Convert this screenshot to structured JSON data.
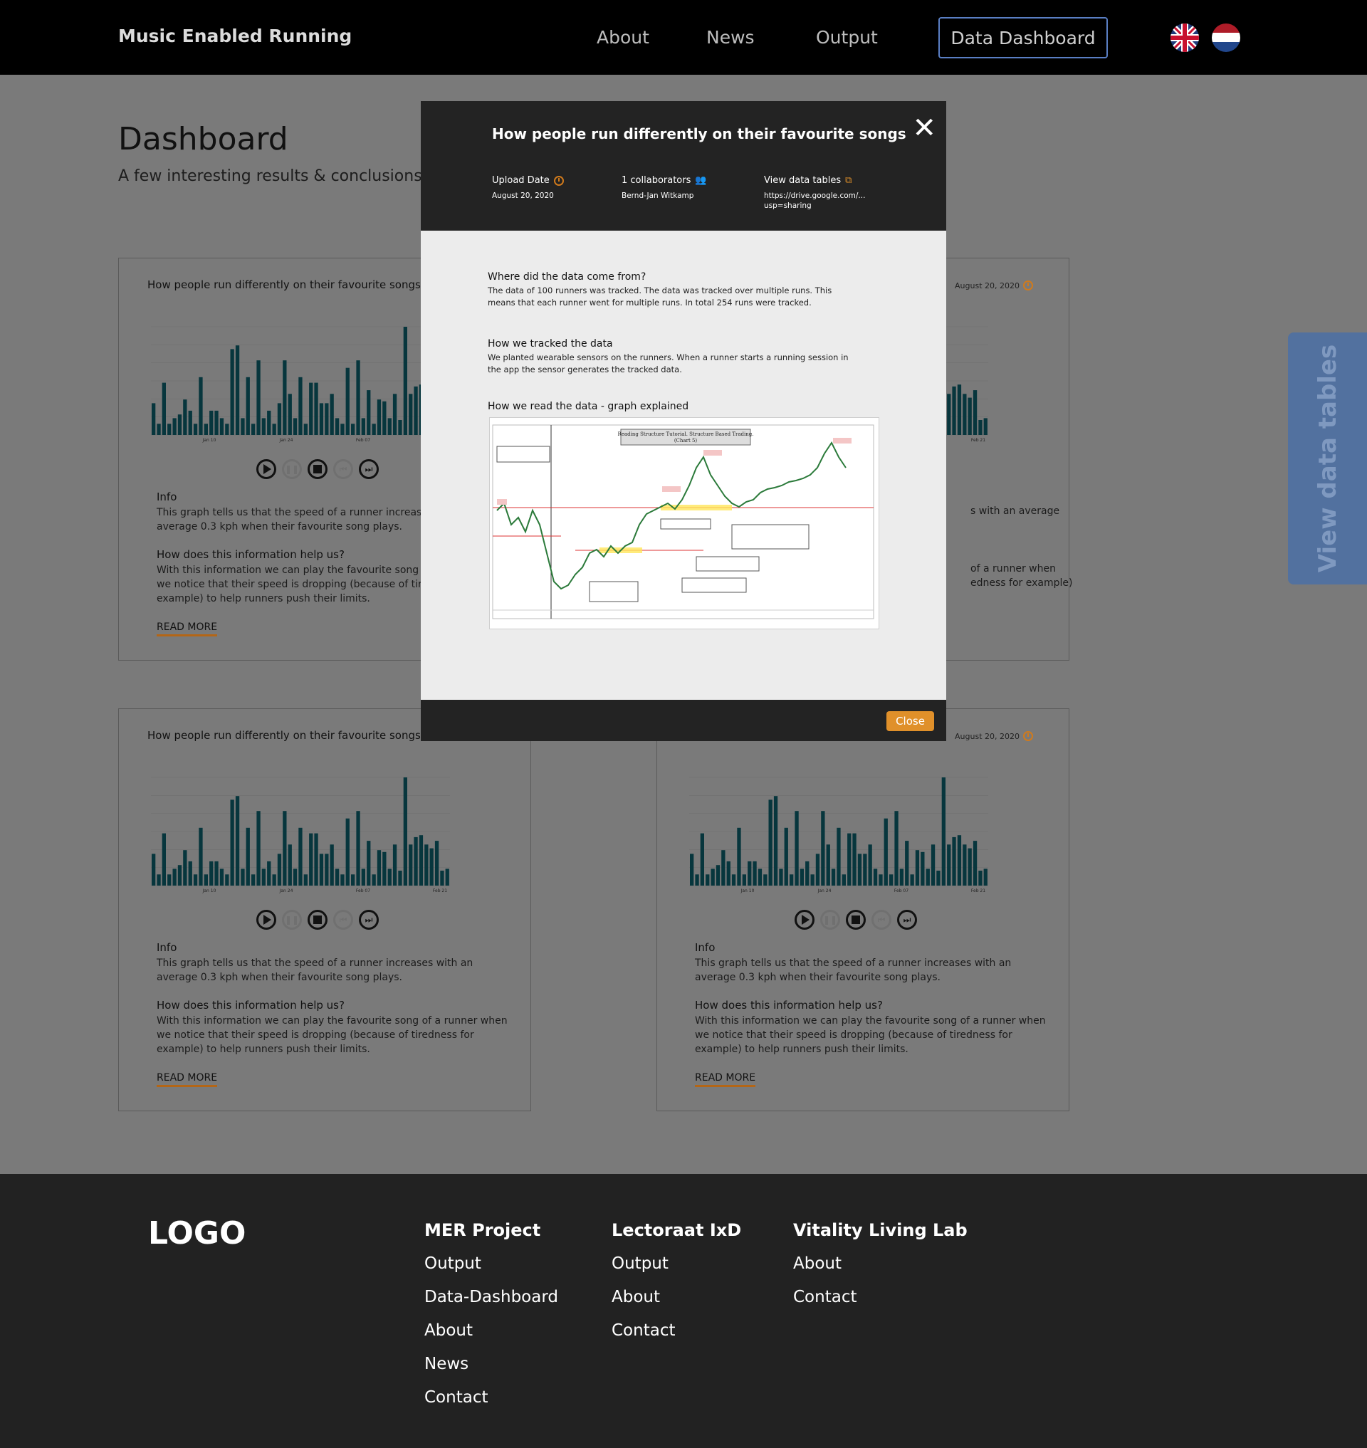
{
  "nav": {
    "brand": "Music Enabled Running",
    "links": [
      "About",
      "News",
      "Output"
    ],
    "dashboard_button": "Data Dashboard",
    "flags": [
      "uk-flag-icon",
      "nl-flag-icon"
    ]
  },
  "page": {
    "title": "Dashboard",
    "subtitle": "A few interesting results & conclusions ba"
  },
  "side_tab": "View data tables",
  "card": {
    "title": "How people run differently on their favourite songs",
    "date": "August 20, 2020",
    "info_heading": "Info",
    "info_text": "This graph tells us that the speed of a runner increases with an average 0.3 kph when their favourite song plays.",
    "help_heading": "How does this information help us?",
    "help_text": "With this information we can play the favourite song of a runner when we notice that their speed is dropping (because of tiredness for example) to help runners push their limits.",
    "read_more": "READ MORE",
    "partial": {
      "info_tail": "s with an average",
      "help_tail_1": "of a runner when",
      "help_tail_2": "edness for example)"
    }
  },
  "chart_data": {
    "type": "bar",
    "values": [
      17,
      6,
      28,
      6,
      9,
      11,
      19,
      13,
      6,
      31,
      6,
      13,
      13,
      9,
      6,
      46,
      48,
      9,
      31,
      6,
      40,
      9,
      13,
      6,
      17,
      40,
      22,
      9,
      31,
      6,
      28,
      28,
      17,
      17,
      22,
      9,
      6,
      36,
      6,
      40,
      9,
      24,
      6,
      19,
      18,
      9,
      22,
      8,
      58,
      22,
      26,
      27,
      22,
      20,
      24,
      8,
      9
    ],
    "xticks": [
      "Jan 10",
      "Jan 24",
      "Feb 07",
      "Feb 21"
    ],
    "grid": true
  },
  "modal": {
    "title": "How people run differently on their favourite songs",
    "upload_label": "Upload Date",
    "upload_value": "August 20, 2020",
    "collab_label": "1 collaborators",
    "collab_value": "Bernd-Jan Witkamp",
    "tables_label": "View data tables",
    "tables_value_1": "https://drive.google.com/...",
    "tables_value_2": "usp=sharing",
    "q1": "Where did the data come from?",
    "a1": "The data of 100 runners was tracked. The data was tracked over multiple runs. This means that each runner went for multiple runs. In total 254 runs were tracked.",
    "q2": "How we tracked the data",
    "a2": "We planted wearable sensors on the runners. When a runner starts a running session in the app the sensor generates the tracked data.",
    "q3": "How we read the data - graph explained",
    "image_title": "Reading Structure Tutorial. Structure Based Trading. (Chart 5)",
    "close_button": "Close"
  },
  "footer": {
    "logo": "LOGO",
    "col1": {
      "heading": "MER Project",
      "links": [
        "Output",
        "Data-Dashboard",
        "About",
        "News",
        "Contact"
      ]
    },
    "col2": {
      "heading": "Lectoraat IxD",
      "links": [
        "Output",
        "About",
        "Contact"
      ]
    },
    "col3": {
      "heading": "Vitality Living Lab",
      "links": [
        "About",
        "Contact"
      ]
    }
  }
}
